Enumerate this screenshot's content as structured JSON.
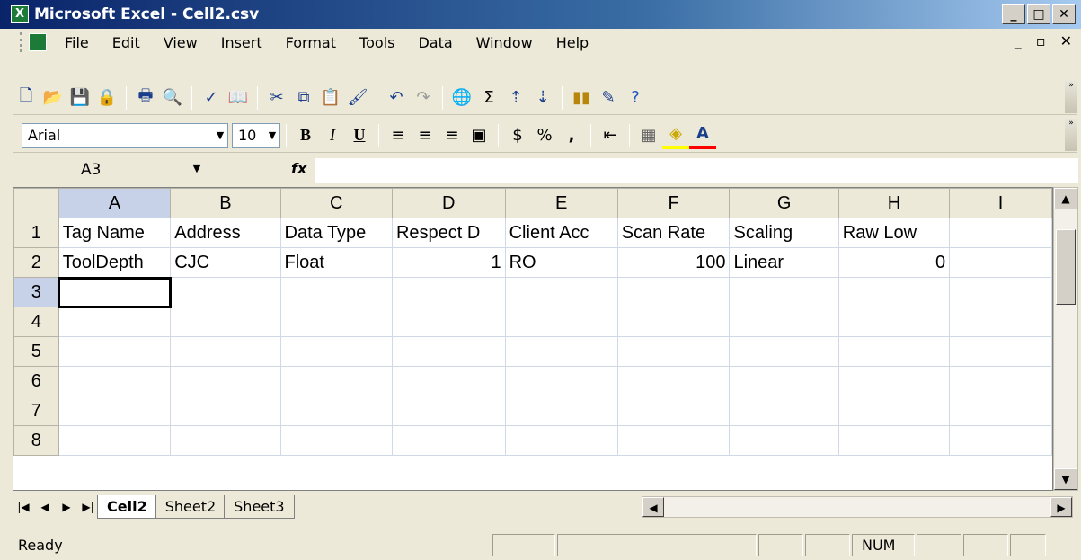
{
  "window": {
    "title": "Microsoft Excel - Cell2.csv",
    "minimize": "_",
    "maximize": "□",
    "close": "✕"
  },
  "menu": [
    "File",
    "Edit",
    "View",
    "Insert",
    "Format",
    "Tools",
    "Data",
    "Window",
    "Help"
  ],
  "formatting": {
    "font": "Arial",
    "size": "10",
    "bold": "B",
    "italic": "I",
    "underline": "U",
    "currency": "$",
    "percent": "%",
    "comma": ","
  },
  "formula_bar": {
    "name_box": "A3",
    "fx": "fx",
    "content": ""
  },
  "columns": [
    "A",
    "B",
    "C",
    "D",
    "E",
    "F",
    "G",
    "H",
    "I"
  ],
  "rows": [
    {
      "num": "1",
      "cells": [
        "Tag Name",
        "Address",
        "Data Type",
        "Respect D",
        "Client Acc",
        "Scan Rate",
        "Scaling",
        "Raw Low",
        ""
      ]
    },
    {
      "num": "2",
      "cells": [
        "ToolDepth",
        "CJC",
        "Float",
        "1",
        "RO",
        "100",
        "Linear",
        "0",
        ""
      ]
    },
    {
      "num": "3",
      "cells": [
        "",
        "",
        "",
        "",
        "",
        "",
        "",
        "",
        ""
      ]
    },
    {
      "num": "4",
      "cells": [
        "",
        "",
        "",
        "",
        "",
        "",
        "",
        "",
        ""
      ]
    },
    {
      "num": "5",
      "cells": [
        "",
        "",
        "",
        "",
        "",
        "",
        "",
        "",
        ""
      ]
    },
    {
      "num": "6",
      "cells": [
        "",
        "",
        "",
        "",
        "",
        "",
        "",
        "",
        ""
      ]
    },
    {
      "num": "7",
      "cells": [
        "",
        "",
        "",
        "",
        "",
        "",
        "",
        "",
        ""
      ]
    },
    {
      "num": "8",
      "cells": [
        "",
        "",
        "",
        "",
        "",
        "",
        "",
        "",
        ""
      ]
    }
  ],
  "active_cell": "A3",
  "sheets": [
    {
      "name": "Cell2",
      "active": true
    },
    {
      "name": "Sheet2",
      "active": false
    },
    {
      "name": "Sheet3",
      "active": false
    }
  ],
  "status": {
    "left": "Ready",
    "num": "NUM"
  },
  "colors": {
    "title_start": "#0a246a",
    "title_end": "#a6caf0",
    "chrome": "#ece9d8",
    "header_active": "#c7d2e8"
  }
}
